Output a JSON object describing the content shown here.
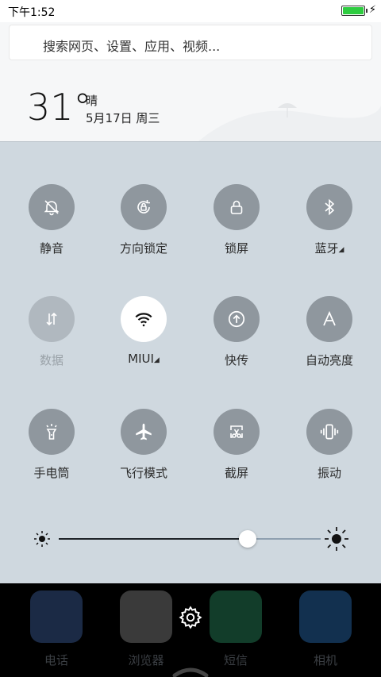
{
  "status_bar": {
    "time": "下午1:52"
  },
  "search": {
    "placeholder": "搜索网页、设置、应用、视频..."
  },
  "weather": {
    "temperature": "31°",
    "condition": "晴",
    "date": "5月17日 周三"
  },
  "tiles": [
    {
      "label": "静音",
      "icon": "bell-off-icon",
      "state": "off"
    },
    {
      "label": "方向锁定",
      "icon": "rotation-lock-icon",
      "state": "off"
    },
    {
      "label": "锁屏",
      "icon": "lock-icon",
      "state": "off"
    },
    {
      "label": "蓝牙",
      "icon": "bluetooth-icon",
      "state": "off",
      "has_menu": true
    },
    {
      "label": "数据",
      "icon": "data-arrows-icon",
      "state": "disabled"
    },
    {
      "label": "MIUI",
      "icon": "wifi-icon",
      "state": "on",
      "has_menu": true
    },
    {
      "label": "快传",
      "icon": "upload-icon",
      "state": "off"
    },
    {
      "label": "自动亮度",
      "icon": "auto-brightness-icon",
      "state": "off"
    },
    {
      "label": "手电筒",
      "icon": "flashlight-icon",
      "state": "off"
    },
    {
      "label": "飞行模式",
      "icon": "airplane-icon",
      "state": "off"
    },
    {
      "label": "截屏",
      "icon": "screenshot-icon",
      "state": "off"
    },
    {
      "label": "振动",
      "icon": "vibrate-icon",
      "state": "off"
    }
  ],
  "brightness": {
    "level": 0.72
  },
  "dock": [
    {
      "label": "电话",
      "icon": "phone-app-icon",
      "color": "#1b2a45"
    },
    {
      "label": "浏览器",
      "icon": "browser-app-icon",
      "color": "#3a3a3a"
    },
    {
      "label": "短信",
      "icon": "messages-app-icon",
      "color": "#123d2a"
    },
    {
      "label": "相机",
      "icon": "camera-app-icon",
      "color": "#12304f"
    }
  ],
  "colors": {
    "tile_off": "#8f979e",
    "tile_on": "#ffffff",
    "panel": "#cfd8df",
    "battery": "#2ecc40"
  }
}
